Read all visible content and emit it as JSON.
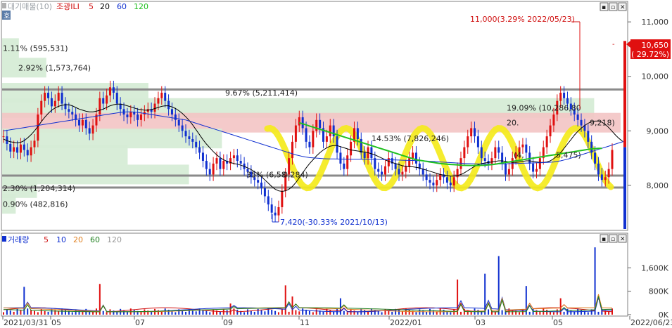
{
  "chart_data": [
    {
      "type": "candlestick",
      "legend": [
        "대기매물(10)",
        "조광ILI",
        "5",
        "20",
        "60",
        "120"
      ],
      "legend_colors": {
        "대기매물(10)": "#9aa0a6",
        "조광ILI": "#d01010",
        "5": "#d01010",
        "20": "#000000",
        "60": "#1030d0",
        "120": "#20c020"
      },
      "ylim": [
        7200,
        11350
      ],
      "y_ticks": [
        "11,000",
        "10,000",
        "9,000",
        "8,000"
      ],
      "y_tick_values": [
        11000,
        10000,
        9000,
        8000
      ],
      "current_price": {
        "label": "10,650",
        "change": "( 29.72%)"
      },
      "annotations": {
        "high": "11,000(3.29% 2022/05/23)",
        "low": "7,420(-30.33% 2021/10/13)"
      },
      "volume_profile": [
        {
          "label": "1.11% (595,531)",
          "price": 10520,
          "pct": 1.11
        },
        {
          "label": "2.92% (1,573,764)",
          "price": 10160,
          "pct": 2.92
        },
        {
          "label": "9.67% (5,211,414)",
          "price": 9700,
          "pct": 9.67
        },
        {
          "label": "19.09% (10,286,80",
          "price": 9420,
          "pct": 19.09
        },
        {
          "label": "20.",
          "label2": "9,218)",
          "price": 9150,
          "pct": 20.0
        },
        {
          "label": "14.53% (7,826,246)",
          "price": 8860,
          "pct": 14.53
        },
        {
          "label": "(4,",
          "label2": "5,475)",
          "price": 8560,
          "pct": 8.3
        },
        {
          "label": "35% (6,58",
          "label2": "0,284)",
          "price": 8200,
          "pct": 12.35
        },
        {
          "label": "2.30% (1,204,314)",
          "price": 7950,
          "pct": 2.3
        },
        {
          "label": "0.90% (482,816)",
          "price": 7660,
          "pct": 0.9
        }
      ],
      "horizontal_lines": [
        9760,
        8180,
        7960
      ],
      "close_series": [
        8900,
        8760,
        8620,
        8700,
        8600,
        8750,
        8650,
        8550,
        8700,
        8820,
        9300,
        9550,
        9700,
        9600,
        9450,
        9550,
        9700,
        9500,
        9400,
        9350,
        9300,
        9200,
        9100,
        9200,
        9050,
        8950,
        9100,
        9300,
        9600,
        9500,
        9650,
        9800,
        9700,
        9500,
        9400,
        9300,
        9250,
        9350,
        9300,
        9200,
        9300,
        9350,
        9400,
        9350,
        9500,
        9600,
        9700,
        9550,
        9400,
        9300,
        9200,
        9100,
        9000,
        8900,
        8850,
        8800,
        8700,
        8600,
        8450,
        8300,
        8200,
        8400,
        8500,
        8300,
        8450,
        8400,
        8500,
        8550,
        8450,
        8400,
        8300,
        8250,
        8150,
        8100,
        8050,
        7950,
        7800,
        7650,
        7500,
        7450,
        7600,
        7900,
        8200,
        8500,
        8800,
        9100,
        9250,
        9050,
        8800,
        8700,
        9000,
        9200,
        9050,
        8800,
        8900,
        9100,
        8900,
        8600,
        8400,
        8300,
        8550,
        8800,
        9050,
        8850,
        8600,
        8500,
        8700,
        8500,
        8300,
        8250,
        8200,
        8350,
        8500,
        8400,
        8300,
        8200,
        8250,
        8350,
        8500,
        8600,
        8400,
        8300,
        8200,
        8100,
        8050,
        8000,
        8100,
        8200,
        8150,
        8050,
        8000,
        8150,
        8300,
        8500,
        8700,
        8900,
        9050,
        8900,
        8700,
        8500,
        8450,
        8400,
        8500,
        8700,
        8600,
        8400,
        8200,
        8300,
        8500,
        8600,
        8700,
        8750,
        8600,
        8400,
        8250,
        8300,
        8500,
        8700,
        8900,
        9100,
        9300,
        9550,
        9700,
        9600,
        9500,
        9400,
        9300,
        9200,
        9100,
        9000,
        8800,
        8600,
        8400,
        8200,
        8100,
        8150,
        8300,
        8650
      ],
      "ma_series": {
        "20": [
          8850,
          8820,
          8800,
          8790,
          8780,
          8790,
          8820,
          8870,
          8930,
          9000,
          9080,
          9170,
          9250,
          9320,
          9380,
          9420,
          9450,
          9470,
          9480,
          9480,
          9460,
          9430,
          9400,
          9380,
          9360,
          9350,
          9350,
          9360,
          9380,
          9400,
          9430,
          9460,
          9480,
          9490,
          9490,
          9480,
          9460,
          9440,
          9420,
          9400,
          9390,
          9380,
          9380,
          9390,
          9410,
          9430,
          9450,
          9460,
          9460,
          9440,
          9410,
          9370,
          9320,
          9260,
          9190,
          9110,
          9020,
          8930,
          8840,
          8760,
          8690,
          8620,
          8560,
          8510,
          8470,
          8440,
          8420,
          8400,
          8390,
          8370,
          8350,
          8320,
          8290,
          8250,
          8210,
          8160,
          8100,
          8040,
          7980,
          7930,
          7900,
          7890,
          7900,
          7930,
          7980,
          8050,
          8140,
          8230,
          8320,
          8400,
          8470,
          8540,
          8600,
          8650,
          8690,
          8720,
          8730,
          8730,
          8710,
          8690,
          8670,
          8650,
          8640,
          8630,
          8620,
          8610,
          8600,
          8580,
          8560,
          8530,
          8500,
          8470,
          8440,
          8420,
          8400,
          8380,
          8360,
          8350,
          8340,
          8340,
          8330,
          8320,
          8300,
          8280,
          8260,
          8240,
          8220,
          8200,
          8190,
          8180,
          8170,
          8170,
          8180,
          8200,
          8230,
          8270,
          8310,
          8350,
          8380,
          8400,
          8410,
          8420,
          8430,
          8440,
          8450,
          8450,
          8440,
          8430,
          8420,
          8420,
          8430,
          8440,
          8450,
          8450,
          8440,
          8430,
          8420,
          8420,
          8430,
          8450,
          8490,
          8540,
          8600,
          8680,
          8760,
          8840,
          8920,
          8990,
          9050,
          9100,
          9140,
          9170,
          9180,
          9180,
          9160,
          9120,
          9060,
          8990,
          8920,
          8860,
          8810
        ],
        "60": [
          9000,
          9010,
          9020,
          9030,
          9040,
          9050,
          9060,
          9070,
          9080,
          9090,
          9100,
          9110,
          9120,
          9130,
          9140,
          9150,
          9160,
          9170,
          9180,
          9190,
          9200,
          9210,
          9220,
          9230,
          9240,
          9250,
          9260,
          9270,
          9280,
          9290,
          9300,
          9310,
          9320,
          9330,
          9340,
          9345,
          9350,
          9350,
          9345,
          9340,
          9330,
          9320,
          9310,
          9300,
          9290,
          9280,
          9270,
          9260,
          9250,
          9240,
          9230,
          9220,
          9210,
          9200,
          9180,
          9160,
          9140,
          9120,
          9100,
          9080,
          9060,
          9040,
          9020,
          9000,
          8980,
          8960,
          8940,
          8920,
          8900,
          8880,
          8860,
          8840,
          8820,
          8800,
          8780,
          8760,
          8740,
          8720,
          8700,
          8680,
          8660,
          8640,
          8620,
          8600,
          8580,
          8560,
          8545,
          8530,
          8520,
          8510,
          8505,
          8500,
          8495,
          8490,
          8488,
          8486,
          8485,
          8484,
          8483,
          8482,
          8481,
          8480,
          8480,
          8480,
          8480,
          8480,
          8480,
          8480,
          8478,
          8476,
          8474,
          8472,
          8470,
          8468,
          8466,
          8464,
          8462,
          8460,
          8458,
          8456,
          8454,
          8452,
          8450,
          8446,
          8442,
          8438,
          8434,
          8430,
          8426,
          8422,
          8418,
          8414,
          8410,
          8406,
          8402,
          8400,
          8398,
          8396,
          8394,
          8392,
          8390,
          8390,
          8390,
          8390,
          8392,
          8394,
          8396,
          8398,
          8400,
          8402,
          8404,
          8406,
          8408,
          8410,
          8412,
          8414,
          8416,
          8418,
          8420,
          8425,
          8430,
          8440,
          8450,
          8465,
          8480,
          8500,
          8520,
          8540,
          8560,
          8580,
          8600,
          8620,
          8640,
          8660,
          8680,
          8700,
          8720,
          8740,
          8760,
          8780,
          8800,
          8810
        ],
        "120": [
          null,
          null,
          null,
          null,
          null,
          null,
          null,
          null,
          null,
          null,
          null,
          null,
          null,
          null,
          null,
          null,
          null,
          null,
          null,
          null,
          null,
          null,
          null,
          null,
          null,
          null,
          null,
          null,
          null,
          null,
          null,
          null,
          null,
          null,
          null,
          null,
          null,
          null,
          null,
          null,
          null,
          null,
          null,
          null,
          null,
          null,
          null,
          null,
          null,
          null,
          null,
          null,
          null,
          null,
          null,
          null,
          null,
          null,
          null,
          null,
          null,
          null,
          null,
          null,
          null,
          null,
          null,
          null,
          null,
          null,
          null,
          null,
          null,
          null,
          null,
          null,
          null,
          null,
          null,
          null,
          null,
          null,
          null,
          null,
          null,
          null,
          9150,
          9130,
          9110,
          9090,
          9070,
          9050,
          9030,
          9010,
          8990,
          8970,
          8950,
          8930,
          8910,
          8890,
          8870,
          8850,
          8830,
          8810,
          8790,
          8770,
          8750,
          8730,
          8710,
          8690,
          8670,
          8650,
          8630,
          8610,
          8590,
          8570,
          8550,
          8530,
          8510,
          8490,
          8470,
          8460,
          8450,
          8440,
          8430,
          8420,
          8410,
          8400,
          8395,
          8390,
          8385,
          8380,
          8375,
          8370,
          8368,
          8366,
          8365,
          8365,
          8366,
          8368,
          8370,
          8375,
          8380,
          8390,
          8400,
          8410,
          8420,
          8430,
          8440,
          8450,
          8460,
          8470,
          8480,
          8490,
          8500,
          8510,
          8520,
          8530,
          8540,
          8550,
          8560,
          8570,
          8580,
          8590,
          8600,
          8610,
          8620,
          8630,
          8640,
          8650,
          8660,
          8670,
          8675,
          8680,
          8680
        ]
      },
      "x_labels": [
        "2021/03/31",
        "05",
        "07",
        "09",
        "11",
        "2022/01",
        "03",
        "05",
        "2022/06/23"
      ]
    },
    {
      "type": "bar",
      "legend": [
        "거래량",
        "5",
        "10",
        "20",
        "60",
        "120"
      ],
      "legend_colors": {
        "거래량": "#1030d0",
        "5": "#d01010",
        "10": "#1030d0",
        "20": "#e08020",
        "60": "#208020",
        "120": "#999999"
      },
      "ylim": [
        0,
        2400000
      ],
      "y_ticks": [
        "1,600K",
        "800K",
        "0K"
      ],
      "y_tick_values": [
        1600000,
        800000,
        0
      ],
      "spikes": [
        {
          "index": 6,
          "value": 950000
        },
        {
          "index": 28,
          "value": 1050000
        },
        {
          "index": 66,
          "value": 380000
        },
        {
          "index": 82,
          "value": 1000000
        },
        {
          "index": 84,
          "value": 620000
        },
        {
          "index": 98,
          "value": 560000
        },
        {
          "index": 132,
          "value": 1200000
        },
        {
          "index": 140,
          "value": 1400000
        },
        {
          "index": 144,
          "value": 2000000
        },
        {
          "index": 152,
          "value": 980000
        },
        {
          "index": 162,
          "value": 560000
        },
        {
          "index": 172,
          "value": 2300000
        },
        {
          "index": 180,
          "value": 650000
        },
        {
          "index": 185,
          "value": 420000
        }
      ],
      "base_value": 140000
    }
  ],
  "ui": {
    "price_axis_marker": "-",
    "price_panel_toggle": "호",
    "window_buttons": [
      "▪",
      "▫",
      "✕"
    ]
  }
}
